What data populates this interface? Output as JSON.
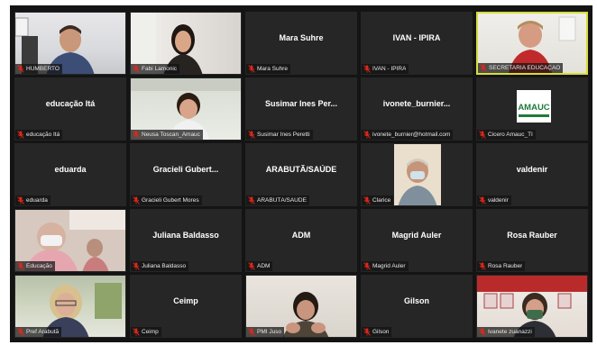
{
  "meeting": {
    "participants": [
      {
        "id": "humberto",
        "type": "video",
        "label": "HUMBERTO"
      },
      {
        "id": "fabi",
        "type": "video",
        "label": "Fabi Lamonic"
      },
      {
        "id": "mara",
        "type": "name",
        "center_name": "Mara Suhre",
        "label": "Mara Suhre"
      },
      {
        "id": "ivan",
        "type": "name",
        "center_name": "IVAN - IPIRA",
        "label": "IVAN - IPIRA"
      },
      {
        "id": "secretaria",
        "type": "video",
        "label": "SECRETARIA EDUCAÇÃO",
        "active": true
      },
      {
        "id": "educacao-ita",
        "type": "name",
        "center_name": "educação Itá",
        "label": "educação Itá"
      },
      {
        "id": "neusa",
        "type": "video",
        "label": "Neusa Toscan_Amauc"
      },
      {
        "id": "susimar",
        "type": "name",
        "center_name": "Susimar Ines Per...",
        "label": "Susimar Ines Peretti"
      },
      {
        "id": "ivonete",
        "type": "name",
        "center_name": "ivonete_burnier...",
        "label": "ivonete_burnier@hotmail.com"
      },
      {
        "id": "cicero",
        "type": "logo",
        "logo_text": "AMAUC",
        "label": "Cicero Amauc_TI"
      },
      {
        "id": "eduarda",
        "type": "name",
        "center_name": "eduarda",
        "label": "eduarda"
      },
      {
        "id": "gracieli",
        "type": "name",
        "center_name": "Gracieli Gubert...",
        "label": "Gracieli Gubert Mores"
      },
      {
        "id": "arabuta-saude",
        "type": "name",
        "center_name": "ARABUTÃ/SAÚDE",
        "label": "ARABUTÃ/SAÚDE"
      },
      {
        "id": "clarice",
        "type": "video",
        "label": "Clarice"
      },
      {
        "id": "valdenir",
        "type": "name",
        "center_name": "valdenir",
        "label": "valdenir"
      },
      {
        "id": "educacao",
        "type": "video",
        "label": "Educação"
      },
      {
        "id": "juliana",
        "type": "name",
        "center_name": "Juliana Baldasso",
        "label": "Juliana Baldasso"
      },
      {
        "id": "adm",
        "type": "name",
        "center_name": "ADM",
        "label": "ADM"
      },
      {
        "id": "magrid",
        "type": "name",
        "center_name": "Magrid Auler",
        "label": "Magrid Auler"
      },
      {
        "id": "rosa",
        "type": "name",
        "center_name": "Rosa Rauber",
        "label": "Rosa Rauber"
      },
      {
        "id": "pref-arabuta",
        "type": "video",
        "label": "Pref Arabutã"
      },
      {
        "id": "ceimp",
        "type": "name",
        "center_name": "Ceimp",
        "label": "Ceimp"
      },
      {
        "id": "pmi-juso",
        "type": "video",
        "label": "PMI Juso"
      },
      {
        "id": "gilson",
        "type": "name",
        "center_name": "Gilson",
        "label": "Gilson"
      },
      {
        "id": "ivanete",
        "type": "video",
        "label": "Ivanete zuanazzi"
      }
    ]
  },
  "colors": {
    "background": "#141414",
    "tile": "#262626",
    "active_border": "#d8dc3a",
    "muted_mic": "#e0261b",
    "logo_green": "#1f7a3a"
  },
  "icons": {
    "muted_mic": "mic-muted-icon"
  }
}
